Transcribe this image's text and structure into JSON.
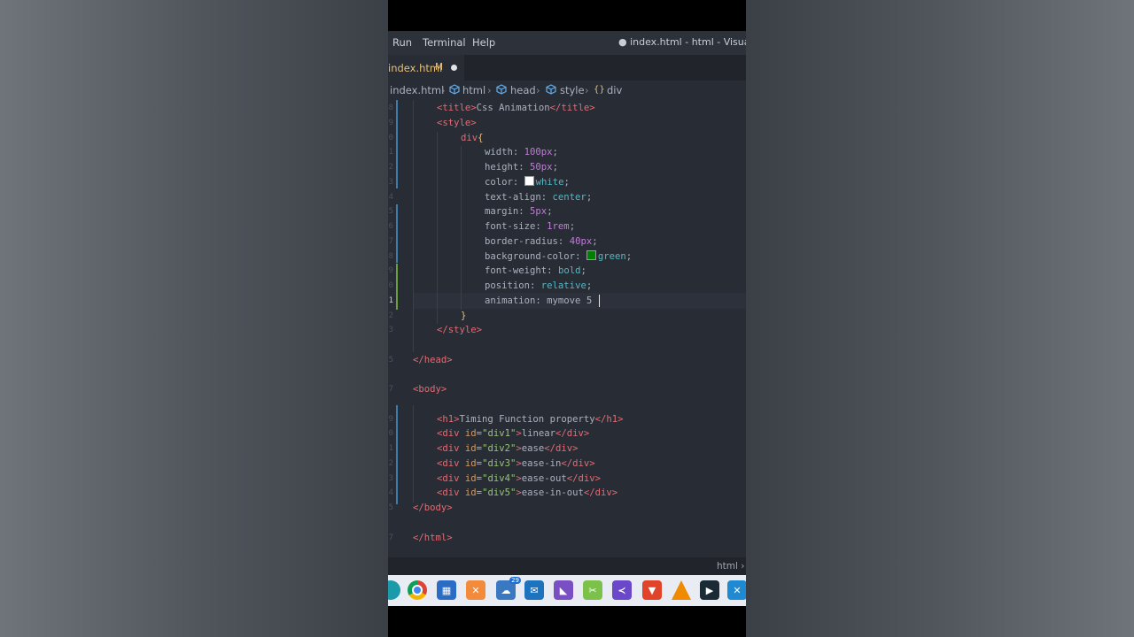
{
  "menu": {
    "items": [
      "Run",
      "Terminal",
      "Help"
    ],
    "window_title": "● index.html - html - Visual Studio Code"
  },
  "tab": {
    "filename": "index.html",
    "modified_badge": "M"
  },
  "breadcrumb": [
    "index.html",
    "html",
    "head",
    "style",
    "div"
  ],
  "status": {
    "language": "html › html"
  },
  "code": {
    "title_line": [
      "<title>",
      "Css Animation",
      "</title>"
    ],
    "style_open": "<style>",
    "selector": "div",
    "open_brace": "{",
    "declarations": [
      {
        "prop": "width",
        "value": "100px"
      },
      {
        "prop": "height",
        "value": "50px"
      },
      {
        "prop": "color",
        "value": "white",
        "swatch": "#ffffff"
      },
      {
        "prop": "text-align",
        "value": "center"
      },
      {
        "prop": "margin",
        "value": "5px"
      },
      {
        "prop": "font-size",
        "value": "1rem"
      },
      {
        "prop": "border-radius",
        "value": "40px"
      },
      {
        "prop": "background-color",
        "value": "green",
        "swatch": "#008000"
      },
      {
        "prop": "font-weight",
        "value": "bold"
      },
      {
        "prop": "position",
        "value": "relative"
      },
      {
        "prop": "animation",
        "value": "mymove 5"
      }
    ],
    "close_brace": "}",
    "style_close": "</style>",
    "head_close": "</head>",
    "body_open": "<body>",
    "h1_line": [
      "<h1>",
      "Timing Function property",
      "</h1>"
    ],
    "divs": [
      {
        "id": "\"div1\"",
        "text": "linear"
      },
      {
        "id": "\"div2\"",
        "text": "ease"
      },
      {
        "id": "\"div3\"",
        "text": "ease-in"
      },
      {
        "id": "\"div4\"",
        "text": "ease-out"
      },
      {
        "id": "\"div5\"",
        "text": "ease-in-out"
      }
    ],
    "body_close": "</body>",
    "html_close": "</html>",
    "line_numbers": [
      "8",
      "9",
      "0",
      "1",
      "2",
      "3",
      "4",
      "5",
      "6",
      "7",
      "8",
      "9",
      "0",
      "1",
      "2",
      "3",
      "4",
      "5",
      "6",
      "7",
      "8",
      "9",
      "0",
      "1",
      "2",
      "3",
      "4",
      "5",
      "6",
      "7"
    ],
    "current_line_number": "1"
  },
  "taskbar": {
    "icons": [
      "edge-icon",
      "chrome-icon",
      "store-icon",
      "xampp-icon",
      "teams-icon",
      "mail-icon",
      "visual-studio-icon",
      "snipping-tool-icon",
      "vs-code-blue-icon",
      "brave-icon",
      "vlc-icon",
      "terminal-icon",
      "vscode-icon"
    ],
    "teams_badge": "29"
  },
  "colors": {
    "editor_bg": "#282c34",
    "tag": "#e06c75",
    "value": "#56b6c2",
    "number": "#c678dd",
    "string": "#98c379"
  }
}
